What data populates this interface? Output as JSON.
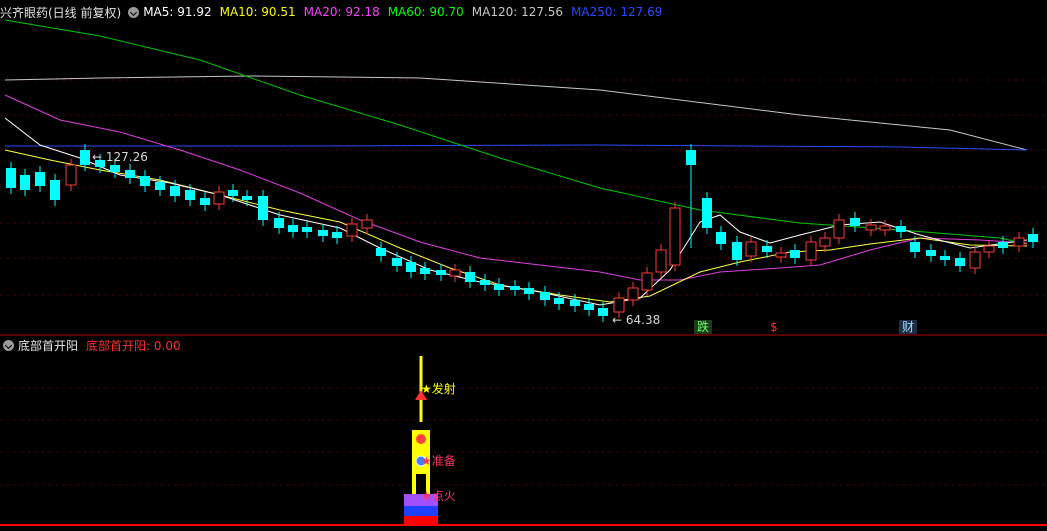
{
  "main_panel": {
    "stock_title": "兴齐眼药(日线 前复权)",
    "ma_items": [
      {
        "label": "MA5: 91.92",
        "color": "#ffffff"
      },
      {
        "label": "MA10: 90.51",
        "color": "#ffff00"
      },
      {
        "label": "MA20: 92.18",
        "color": "#ff40ff"
      },
      {
        "label": "MA60: 90.70",
        "color": "#00ff00"
      },
      {
        "label": "MA120: 127.56",
        "color": "#c8c8c8"
      },
      {
        "label": "MA250: 127.69",
        "color": "#2a4cff"
      }
    ],
    "high_label": "127.26",
    "low_label": "64.38",
    "events": [
      {
        "text": "跌",
        "color": "#66ff66",
        "bg": "#1e3a1e"
      },
      {
        "text": "$",
        "color": "#ff3030",
        "bg": "transparent"
      },
      {
        "text": "财",
        "color": "#9fdcff",
        "bg": "#1c2f44"
      }
    ]
  },
  "indicator_panel": {
    "name": "底部首开阳",
    "value_label": "底部首开阳: 0.00",
    "signals": {
      "launch": "发射",
      "prepare": "准备",
      "ignite": "点火"
    }
  },
  "colors": {
    "up": "#ff3a3a",
    "down": "#00ffff",
    "separator": "#b00000"
  }
}
